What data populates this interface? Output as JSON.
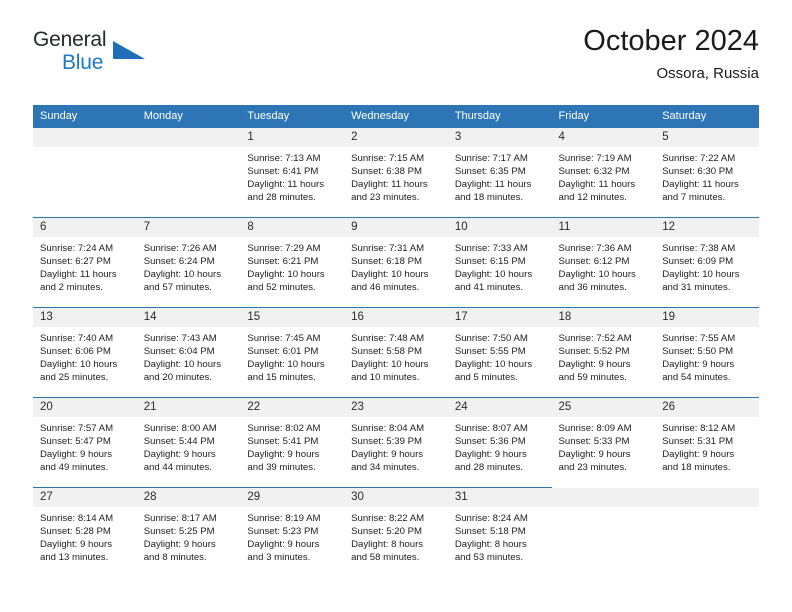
{
  "brand": {
    "name_part1": "General",
    "name_part2": "Blue",
    "triangle_icon": "triangle-logo-icon",
    "accent_color": "#1e7ac4"
  },
  "header": {
    "title": "October 2024",
    "subtitle": "Ossora, Russia"
  },
  "theme": {
    "header_blue": "#2e75b6",
    "daynum_background": "#f1f1f1",
    "page_background": "#ffffff"
  },
  "calendar": {
    "weekday_headers": [
      "Sunday",
      "Monday",
      "Tuesday",
      "Wednesday",
      "Thursday",
      "Friday",
      "Saturday"
    ],
    "labels": {
      "sunrise_prefix": "Sunrise: ",
      "sunset_prefix": "Sunset: ",
      "daylight_prefix": "Daylight: "
    },
    "weeks": [
      [
        {
          "day": "",
          "empty": true
        },
        {
          "day": "",
          "empty": true
        },
        {
          "day": "1",
          "sunrise": "Sunrise: 7:13 AM",
          "sunset": "Sunset: 6:41 PM",
          "daylight": "Daylight: 11 hours and 28 minutes."
        },
        {
          "day": "2",
          "sunrise": "Sunrise: 7:15 AM",
          "sunset": "Sunset: 6:38 PM",
          "daylight": "Daylight: 11 hours and 23 minutes."
        },
        {
          "day": "3",
          "sunrise": "Sunrise: 7:17 AM",
          "sunset": "Sunset: 6:35 PM",
          "daylight": "Daylight: 11 hours and 18 minutes."
        },
        {
          "day": "4",
          "sunrise": "Sunrise: 7:19 AM",
          "sunset": "Sunset: 6:32 PM",
          "daylight": "Daylight: 11 hours and 12 minutes."
        },
        {
          "day": "5",
          "sunrise": "Sunrise: 7:22 AM",
          "sunset": "Sunset: 6:30 PM",
          "daylight": "Daylight: 11 hours and 7 minutes."
        }
      ],
      [
        {
          "day": "6",
          "sunrise": "Sunrise: 7:24 AM",
          "sunset": "Sunset: 6:27 PM",
          "daylight": "Daylight: 11 hours and 2 minutes."
        },
        {
          "day": "7",
          "sunrise": "Sunrise: 7:26 AM",
          "sunset": "Sunset: 6:24 PM",
          "daylight": "Daylight: 10 hours and 57 minutes."
        },
        {
          "day": "8",
          "sunrise": "Sunrise: 7:29 AM",
          "sunset": "Sunset: 6:21 PM",
          "daylight": "Daylight: 10 hours and 52 minutes."
        },
        {
          "day": "9",
          "sunrise": "Sunrise: 7:31 AM",
          "sunset": "Sunset: 6:18 PM",
          "daylight": "Daylight: 10 hours and 46 minutes."
        },
        {
          "day": "10",
          "sunrise": "Sunrise: 7:33 AM",
          "sunset": "Sunset: 6:15 PM",
          "daylight": "Daylight: 10 hours and 41 minutes."
        },
        {
          "day": "11",
          "sunrise": "Sunrise: 7:36 AM",
          "sunset": "Sunset: 6:12 PM",
          "daylight": "Daylight: 10 hours and 36 minutes."
        },
        {
          "day": "12",
          "sunrise": "Sunrise: 7:38 AM",
          "sunset": "Sunset: 6:09 PM",
          "daylight": "Daylight: 10 hours and 31 minutes."
        }
      ],
      [
        {
          "day": "13",
          "sunrise": "Sunrise: 7:40 AM",
          "sunset": "Sunset: 6:06 PM",
          "daylight": "Daylight: 10 hours and 25 minutes."
        },
        {
          "day": "14",
          "sunrise": "Sunrise: 7:43 AM",
          "sunset": "Sunset: 6:04 PM",
          "daylight": "Daylight: 10 hours and 20 minutes."
        },
        {
          "day": "15",
          "sunrise": "Sunrise: 7:45 AM",
          "sunset": "Sunset: 6:01 PM",
          "daylight": "Daylight: 10 hours and 15 minutes."
        },
        {
          "day": "16",
          "sunrise": "Sunrise: 7:48 AM",
          "sunset": "Sunset: 5:58 PM",
          "daylight": "Daylight: 10 hours and 10 minutes."
        },
        {
          "day": "17",
          "sunrise": "Sunrise: 7:50 AM",
          "sunset": "Sunset: 5:55 PM",
          "daylight": "Daylight: 10 hours and 5 minutes."
        },
        {
          "day": "18",
          "sunrise": "Sunrise: 7:52 AM",
          "sunset": "Sunset: 5:52 PM",
          "daylight": "Daylight: 9 hours and 59 minutes."
        },
        {
          "day": "19",
          "sunrise": "Sunrise: 7:55 AM",
          "sunset": "Sunset: 5:50 PM",
          "daylight": "Daylight: 9 hours and 54 minutes."
        }
      ],
      [
        {
          "day": "20",
          "sunrise": "Sunrise: 7:57 AM",
          "sunset": "Sunset: 5:47 PM",
          "daylight": "Daylight: 9 hours and 49 minutes."
        },
        {
          "day": "21",
          "sunrise": "Sunrise: 8:00 AM",
          "sunset": "Sunset: 5:44 PM",
          "daylight": "Daylight: 9 hours and 44 minutes."
        },
        {
          "day": "22",
          "sunrise": "Sunrise: 8:02 AM",
          "sunset": "Sunset: 5:41 PM",
          "daylight": "Daylight: 9 hours and 39 minutes."
        },
        {
          "day": "23",
          "sunrise": "Sunrise: 8:04 AM",
          "sunset": "Sunset: 5:39 PM",
          "daylight": "Daylight: 9 hours and 34 minutes."
        },
        {
          "day": "24",
          "sunrise": "Sunrise: 8:07 AM",
          "sunset": "Sunset: 5:36 PM",
          "daylight": "Daylight: 9 hours and 28 minutes."
        },
        {
          "day": "25",
          "sunrise": "Sunrise: 8:09 AM",
          "sunset": "Sunset: 5:33 PM",
          "daylight": "Daylight: 9 hours and 23 minutes."
        },
        {
          "day": "26",
          "sunrise": "Sunrise: 8:12 AM",
          "sunset": "Sunset: 5:31 PM",
          "daylight": "Daylight: 9 hours and 18 minutes."
        }
      ],
      [
        {
          "day": "27",
          "sunrise": "Sunrise: 8:14 AM",
          "sunset": "Sunset: 5:28 PM",
          "daylight": "Daylight: 9 hours and 13 minutes."
        },
        {
          "day": "28",
          "sunrise": "Sunrise: 8:17 AM",
          "sunset": "Sunset: 5:25 PM",
          "daylight": "Daylight: 9 hours and 8 minutes."
        },
        {
          "day": "29",
          "sunrise": "Sunrise: 8:19 AM",
          "sunset": "Sunset: 5:23 PM",
          "daylight": "Daylight: 9 hours and 3 minutes."
        },
        {
          "day": "30",
          "sunrise": "Sunrise: 8:22 AM",
          "sunset": "Sunset: 5:20 PM",
          "daylight": "Daylight: 8 hours and 58 minutes."
        },
        {
          "day": "31",
          "sunrise": "Sunrise: 8:24 AM",
          "sunset": "Sunset: 5:18 PM",
          "daylight": "Daylight: 8 hours and 53 minutes."
        },
        {
          "day": "",
          "empty": true
        },
        {
          "day": "",
          "empty": true
        }
      ]
    ]
  }
}
